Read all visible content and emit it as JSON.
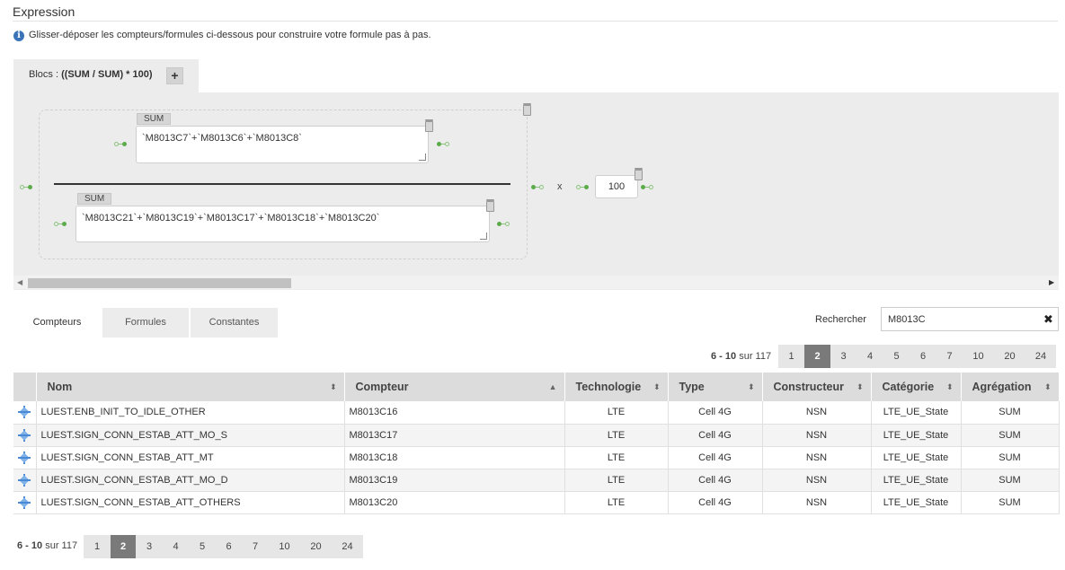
{
  "header": {
    "title": "Expression",
    "info_text": "Glisser-déposer les compteurs/formules ci-dessous pour construire votre formule pas à pas."
  },
  "blocs": {
    "label_prefix": "Blocs : ",
    "expression": "((SUM / SUM) * 100)",
    "add_label": "+"
  },
  "canvas": {
    "numerator": {
      "tag": "SUM",
      "formula": "`M8013C7`+`M8013C6`+`M8013C8`"
    },
    "denominator": {
      "tag": "SUM",
      "formula": "`M8013C21`+`M8013C19`+`M8013C17`+`M8013C18`+`M8013C20`"
    },
    "operator": "x",
    "constant": "100"
  },
  "tabs": [
    {
      "label": "Compteurs",
      "active": true
    },
    {
      "label": "Formules",
      "active": false
    },
    {
      "label": "Constantes",
      "active": false
    }
  ],
  "search": {
    "label": "Rechercher",
    "value": "M8013C",
    "clear": "✖"
  },
  "pagination": {
    "info_range": "6 - 10",
    "info_rest": " sur 117",
    "top_pages": [
      "1",
      "2",
      "3",
      "4",
      "5",
      "6",
      "7",
      "10",
      "20",
      "24"
    ],
    "bottom_pages": [
      "1",
      "2",
      "3",
      "4",
      "5",
      "6",
      "7",
      "10",
      "20",
      "24"
    ],
    "active": "2"
  },
  "table": {
    "columns": [
      {
        "label": "Nom",
        "sort": "⬍"
      },
      {
        "label": "Compteur",
        "sort": "▲"
      },
      {
        "label": "Technologie",
        "sort": "⬍"
      },
      {
        "label": "Type",
        "sort": "⬍"
      },
      {
        "label": "Constructeur",
        "sort": "⬍"
      },
      {
        "label": "Catégorie",
        "sort": "⬍"
      },
      {
        "label": "Agrégation",
        "sort": "⬍"
      }
    ],
    "rows": [
      [
        "LUEST.ENB_INIT_TO_IDLE_OTHER",
        "M8013C16",
        "LTE",
        "Cell 4G",
        "NSN",
        "LTE_UE_State",
        "SUM"
      ],
      [
        "LUEST.SIGN_CONN_ESTAB_ATT_MO_S",
        "M8013C17",
        "LTE",
        "Cell 4G",
        "NSN",
        "LTE_UE_State",
        "SUM"
      ],
      [
        "LUEST.SIGN_CONN_ESTAB_ATT_MT",
        "M8013C18",
        "LTE",
        "Cell 4G",
        "NSN",
        "LTE_UE_State",
        "SUM"
      ],
      [
        "LUEST.SIGN_CONN_ESTAB_ATT_MO_D",
        "M8013C19",
        "LTE",
        "Cell 4G",
        "NSN",
        "LTE_UE_State",
        "SUM"
      ],
      [
        "LUEST.SIGN_CONN_ESTAB_ATT_OTHERS",
        "M8013C20",
        "LTE",
        "Cell 4G",
        "NSN",
        "LTE_UE_State",
        "SUM"
      ]
    ]
  }
}
